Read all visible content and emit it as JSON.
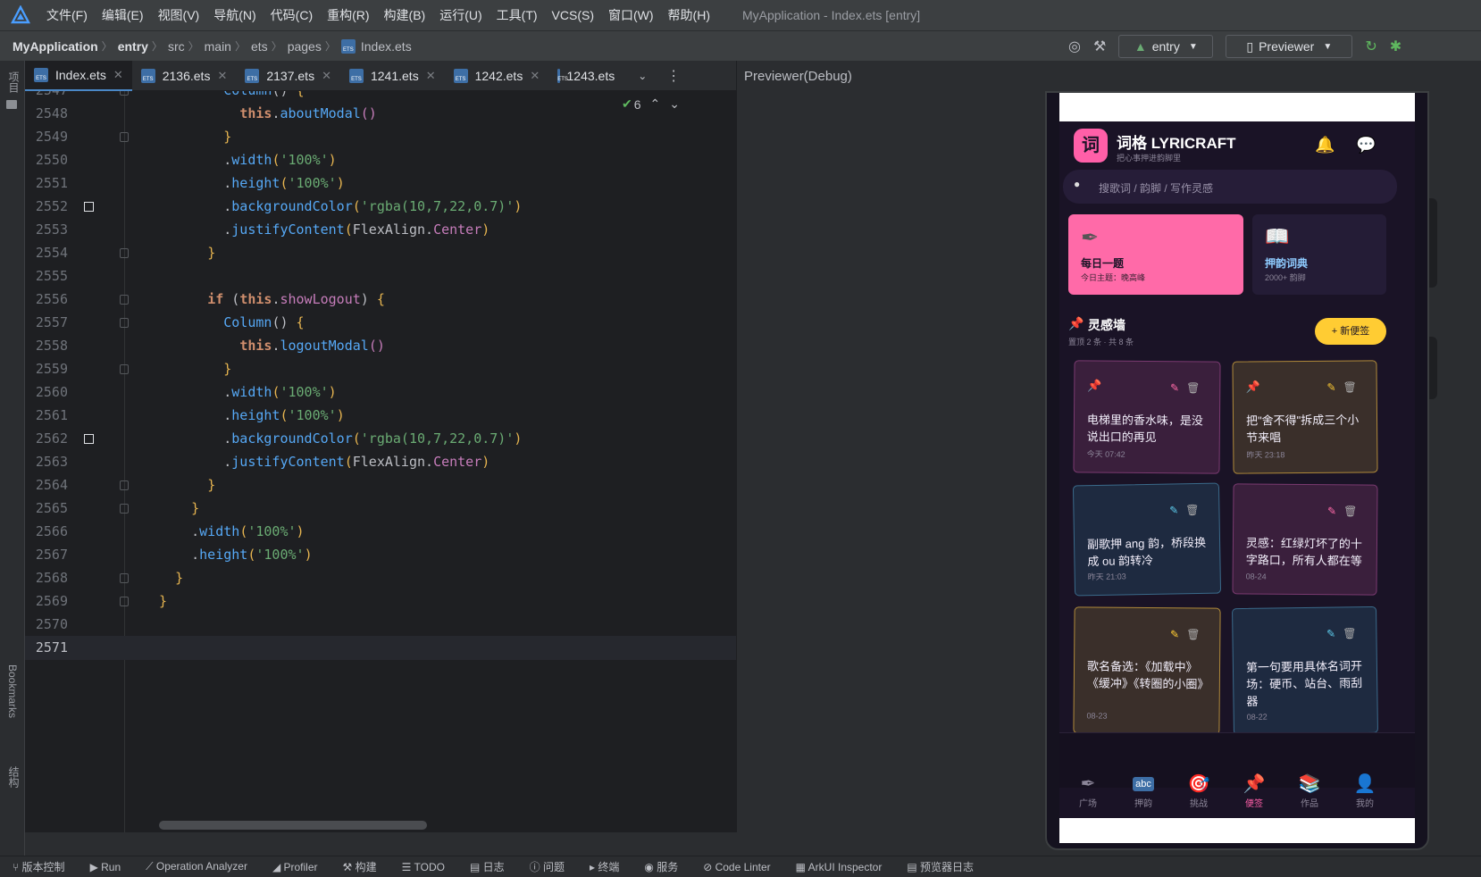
{
  "menubar": {
    "items": [
      "文件(F)",
      "编辑(E)",
      "视图(V)",
      "导航(N)",
      "代码(C)",
      "重构(R)",
      "构建(B)",
      "运行(U)",
      "工具(T)",
      "VCS(S)",
      "窗口(W)",
      "帮助(H)"
    ],
    "window_title": "MyApplication - Index.ets [entry]"
  },
  "navbar": {
    "crumbs": [
      "MyApplication",
      "entry",
      "src",
      "main",
      "ets",
      "pages",
      "Index.ets"
    ],
    "run_config": "entry",
    "device": "Previewer"
  },
  "sidebar": {
    "project_label": "项目",
    "bookmarks_label": "Bookmarks",
    "structure_label": "结构"
  },
  "tabs": [
    "Index.ets",
    "2136.ets",
    "2137.ets",
    "1241.ets",
    "1242.ets",
    "1243.ets"
  ],
  "editor": {
    "problems_count": "6",
    "lines": [
      {
        "n": "2547",
        "segs": [
          [
            "        ",
            ""
          ],
          [
            "Column",
            "fn"
          ],
          [
            "() ",
            ""
          ],
          [
            "{",
            "br1"
          ]
        ],
        "fold": true
      },
      {
        "n": "2548",
        "segs": [
          [
            "          ",
            ""
          ],
          [
            "this",
            "this"
          ],
          [
            ".",
            ""
          ],
          [
            "aboutModal",
            "fn"
          ],
          [
            "()",
            "br2"
          ]
        ]
      },
      {
        "n": "2549",
        "segs": [
          [
            "        ",
            ""
          ],
          [
            "}",
            "br1"
          ]
        ],
        "fold": true
      },
      {
        "n": "2550",
        "segs": [
          [
            "        .",
            ""
          ],
          [
            "width",
            "fn"
          ],
          [
            "(",
            "br1"
          ],
          [
            "'100%'",
            "str"
          ],
          [
            ")",
            "br1"
          ]
        ]
      },
      {
        "n": "2551",
        "segs": [
          [
            "        .",
            ""
          ],
          [
            "height",
            "fn"
          ],
          [
            "(",
            "br1"
          ],
          [
            "'100%'",
            "str"
          ],
          [
            ")",
            "br1"
          ]
        ]
      },
      {
        "n": "2552",
        "segs": [
          [
            "        .",
            ""
          ],
          [
            "backgroundColor",
            "fn"
          ],
          [
            "(",
            "br1"
          ],
          [
            "'rgba(10,7,22,0.7)'",
            "str"
          ],
          [
            ")",
            "br1"
          ]
        ],
        "bp": true
      },
      {
        "n": "2553",
        "segs": [
          [
            "        .",
            ""
          ],
          [
            "justifyContent",
            "fn"
          ],
          [
            "(",
            "br1"
          ],
          [
            "FlexAlign",
            ""
          ],
          [
            ".",
            ""
          ],
          [
            "Center",
            "prop"
          ],
          [
            ")",
            "br1"
          ]
        ]
      },
      {
        "n": "2554",
        "segs": [
          [
            "      ",
            ""
          ],
          [
            "}",
            "br1"
          ]
        ],
        "fold": true
      },
      {
        "n": "2555",
        "segs": [
          [
            "",
            ""
          ]
        ]
      },
      {
        "n": "2556",
        "segs": [
          [
            "      ",
            ""
          ],
          [
            "if",
            "kwb"
          ],
          [
            " (",
            ""
          ],
          [
            "this",
            "this"
          ],
          [
            ".",
            ""
          ],
          [
            "showLogout",
            "prop"
          ],
          [
            ") ",
            ""
          ],
          [
            "{",
            "br1"
          ]
        ],
        "fold": true
      },
      {
        "n": "2557",
        "segs": [
          [
            "        ",
            ""
          ],
          [
            "Column",
            "fn"
          ],
          [
            "() ",
            ""
          ],
          [
            "{",
            "br1"
          ]
        ],
        "fold": true
      },
      {
        "n": "2558",
        "segs": [
          [
            "          ",
            ""
          ],
          [
            "this",
            "this"
          ],
          [
            ".",
            ""
          ],
          [
            "logoutModal",
            "fn"
          ],
          [
            "()",
            "br2"
          ]
        ]
      },
      {
        "n": "2559",
        "segs": [
          [
            "        ",
            ""
          ],
          [
            "}",
            "br1"
          ]
        ],
        "fold": true
      },
      {
        "n": "2560",
        "segs": [
          [
            "        .",
            ""
          ],
          [
            "width",
            "fn"
          ],
          [
            "(",
            "br1"
          ],
          [
            "'100%'",
            "str"
          ],
          [
            ")",
            "br1"
          ]
        ]
      },
      {
        "n": "2561",
        "segs": [
          [
            "        .",
            ""
          ],
          [
            "height",
            "fn"
          ],
          [
            "(",
            "br1"
          ],
          [
            "'100%'",
            "str"
          ],
          [
            ")",
            "br1"
          ]
        ]
      },
      {
        "n": "2562",
        "segs": [
          [
            "        .",
            ""
          ],
          [
            "backgroundColor",
            "fn"
          ],
          [
            "(",
            "br1"
          ],
          [
            "'rgba(10,7,22,0.7)'",
            "str"
          ],
          [
            ")",
            "br1"
          ]
        ],
        "bp": true
      },
      {
        "n": "2563",
        "segs": [
          [
            "        .",
            ""
          ],
          [
            "justifyContent",
            "fn"
          ],
          [
            "(",
            "br1"
          ],
          [
            "FlexAlign",
            ""
          ],
          [
            ".",
            ""
          ],
          [
            "Center",
            "prop"
          ],
          [
            ")",
            "br1"
          ]
        ]
      },
      {
        "n": "2564",
        "segs": [
          [
            "      ",
            ""
          ],
          [
            "}",
            "br1"
          ]
        ],
        "fold": true
      },
      {
        "n": "2565",
        "segs": [
          [
            "    ",
            ""
          ],
          [
            "}",
            "br1"
          ]
        ],
        "fold": true
      },
      {
        "n": "2566",
        "segs": [
          [
            "    .",
            ""
          ],
          [
            "width",
            "fn"
          ],
          [
            "(",
            "br1"
          ],
          [
            "'100%'",
            "str"
          ],
          [
            ")",
            "br1"
          ]
        ]
      },
      {
        "n": "2567",
        "segs": [
          [
            "    .",
            ""
          ],
          [
            "height",
            "fn"
          ],
          [
            "(",
            "br1"
          ],
          [
            "'100%'",
            "str"
          ],
          [
            ")",
            "br1"
          ]
        ]
      },
      {
        "n": "2568",
        "segs": [
          [
            "  ",
            ""
          ],
          [
            "}",
            "br1"
          ]
        ],
        "fold": true
      },
      {
        "n": "2569",
        "segs": [
          [
            "",
            ""
          ],
          [
            "}",
            "br1"
          ]
        ],
        "fold": true
      },
      {
        "n": "2570",
        "segs": [
          [
            "",
            ""
          ]
        ]
      },
      {
        "n": "2571",
        "segs": [
          [
            "",
            ""
          ]
        ],
        "current": true
      }
    ]
  },
  "previewer": {
    "title": "Previewer(Debug)",
    "app": {
      "logo_char": "词",
      "title": "词格 LYRICRAFT",
      "subtitle": "把心事押进韵脚里",
      "search_placeholder": "搜歌词 / 韵脚 / 写作灵感",
      "card1_title": "每日一题",
      "card1_sub": "今日主题：晚高峰",
      "card2_title": "押韵词典",
      "card2_sub": "2000+ 韵脚",
      "section_title": "灵感墙",
      "section_sub": "置顶 2 条 · 共 8 条",
      "new_note_label": "+ 新便签",
      "notes": [
        {
          "text": "电梯里的香水味，是没说出口的再见",
          "time": "今天 07:42"
        },
        {
          "text": "把\"舍不得\"拆成三个小节来唱",
          "time": "昨天 23:18"
        },
        {
          "text": "副歌押 ang 韵，桥段换成 ou 韵转冷",
          "time": "昨天 21:03"
        },
        {
          "text": "灵感：红绿灯坏了的十字路口，所有人都在等",
          "time": "08-24"
        },
        {
          "text": "歌名备选：《加载中》《缓冲》《转圈的小圈》",
          "time": "08-23"
        },
        {
          "text": "第一句要用具体名词开场：硬币、站台、雨刮器",
          "time": "08-22"
        }
      ],
      "nav": [
        "广场",
        "押韵",
        "挑战",
        "便签",
        "作品",
        "我的"
      ]
    }
  },
  "bottombar": [
    "版本控制",
    "Run",
    "Operation Analyzer",
    "Profiler",
    "构建",
    "TODO",
    "日志",
    "问题",
    "终端",
    "服务",
    "Code Linter",
    "ArkUI Inspector",
    "预览器日志"
  ]
}
